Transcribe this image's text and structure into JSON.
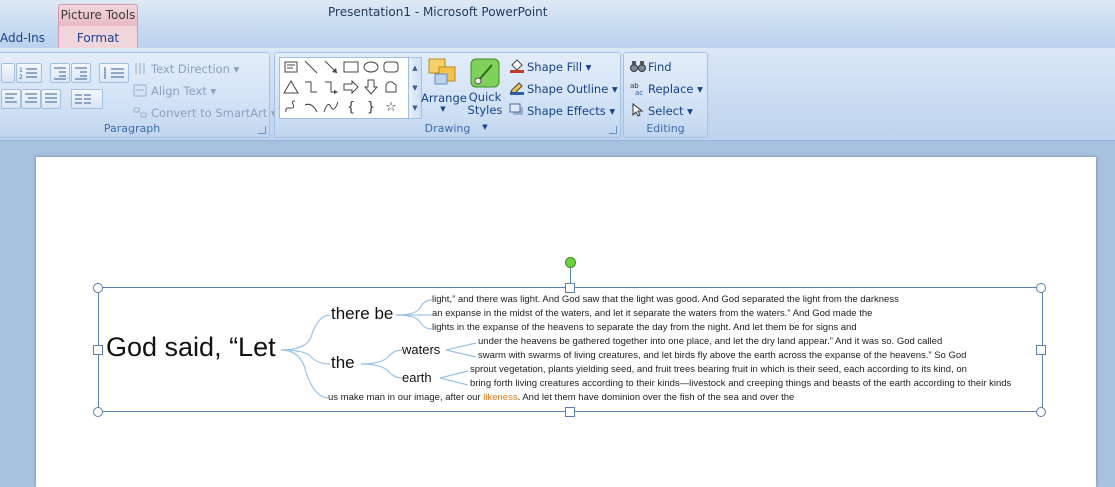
{
  "titlebar": {
    "contextual_tab": "Picture Tools",
    "window_title": "Presentation1 - Microsoft PowerPoint"
  },
  "tabs": {
    "addins": "Add-Ins",
    "format": "Format"
  },
  "ribbon": {
    "paragraph": {
      "label": "Paragraph",
      "text_direction": "Text Direction",
      "align_text": "Align Text",
      "convert_smartart": "Convert to SmartArt"
    },
    "drawing": {
      "label": "Drawing",
      "arrange": "Arrange",
      "quick_styles_1": "Quick",
      "quick_styles_2": "Styles",
      "shape_fill": "Shape Fill",
      "shape_outline": "Shape Outline",
      "shape_effects": "Shape Effects"
    },
    "editing": {
      "label": "Editing",
      "find": "Find",
      "replace": "Replace",
      "select": "Select"
    }
  },
  "slide": {
    "root": "God said, “Let",
    "branch_there_be": "there be",
    "branch_the": "the",
    "sub_waters": "waters",
    "sub_earth": "earth",
    "leaves": {
      "l1": "light,” and there was light. And God saw that the light was good. And God separated the light from the darkness",
      "l2": "an expanse in the midst of the waters, and let it separate the waters from the waters.” And God made the",
      "l3": "lights in the expanse of the heavens to separate the day from the night. And let them be for signs and",
      "l4": "under the heavens be gathered together into one place, and let the dry land appear.” And it was so. God called",
      "l5": "swarm with swarms of living creatures, and let birds fly above the earth across the expanse of the heavens.” So God",
      "l6": "sprout vegetation, plants yielding seed, and fruit trees bearing fruit in which is their seed, each according to its kind, on",
      "l7": "bring forth living creatures according to their kinds—livestock and creeping things and beasts of the earth according to their kinds",
      "l8_pre": "us make man in our image, after our ",
      "l8_hl": "likeness",
      "l8_post": ". And let them have dominion over the fish of the sea and over the"
    }
  },
  "colors": {
    "highlight": "#e07b1c",
    "branch": "#9cc3e6",
    "rotate_handle": "#6fd13f"
  }
}
